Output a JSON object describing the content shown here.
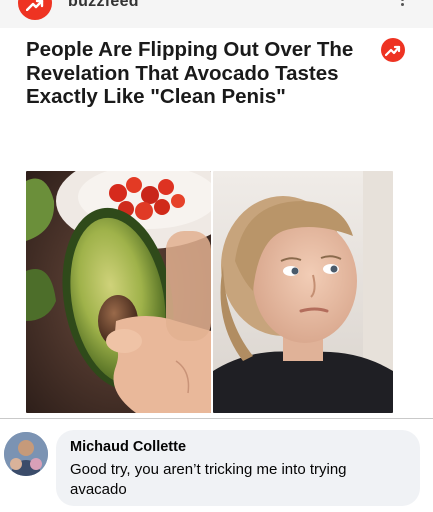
{
  "header": {
    "source_name": "buzzfeed",
    "brand_color": "#ee3322",
    "menu_icon": "more-vertical-icon"
  },
  "article": {
    "headline": "People Are Flipping Out Over The Revelation That Avocado Tastes Exactly Like \"Clean Penis\"",
    "badge_icon": "trending-icon",
    "images": [
      "avocado-photo",
      "woman-reaction-photo"
    ]
  },
  "comment": {
    "author": "Michaud Collette",
    "text": "Good try, you aren’t tricking me into trying avacado",
    "bubble_color": "#f0f2f5"
  }
}
